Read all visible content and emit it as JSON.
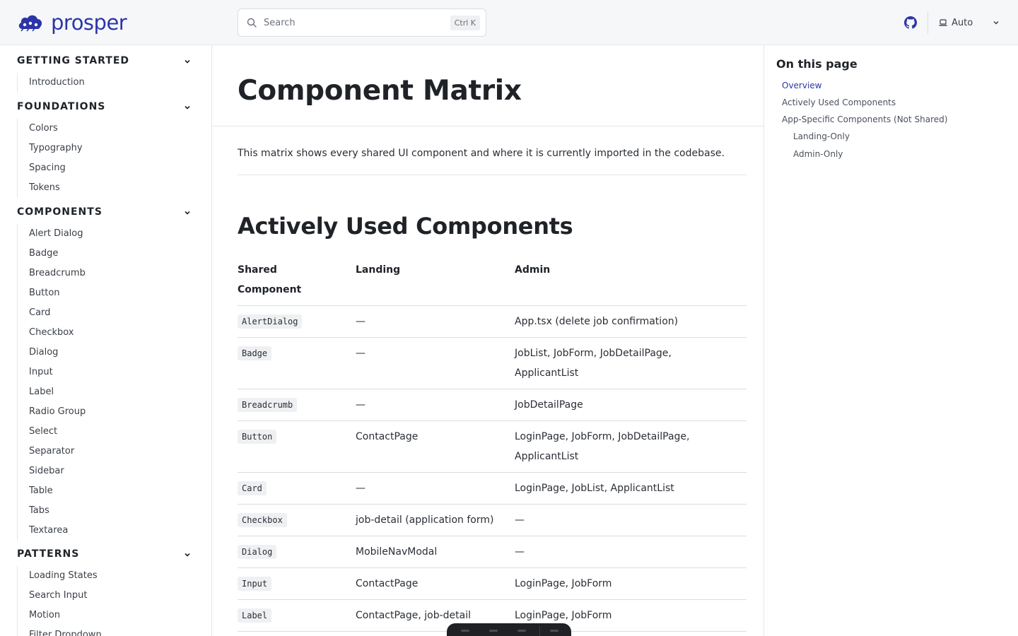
{
  "header": {
    "logo_text": "prosper",
    "search_placeholder": "Search",
    "search_shortcut": "Ctrl K",
    "theme_label": "Auto"
  },
  "sidebar": {
    "sections": [
      {
        "title": "GETTING STARTED",
        "items": [
          "Introduction"
        ]
      },
      {
        "title": "FOUNDATIONS",
        "items": [
          "Colors",
          "Typography",
          "Spacing",
          "Tokens"
        ]
      },
      {
        "title": "COMPONENTS",
        "items": [
          "Alert Dialog",
          "Badge",
          "Breadcrumb",
          "Button",
          "Card",
          "Checkbox",
          "Dialog",
          "Input",
          "Label",
          "Radio Group",
          "Select",
          "Separator",
          "Sidebar",
          "Table",
          "Tabs",
          "Textarea"
        ]
      },
      {
        "title": "PATTERNS",
        "items": [
          "Loading States",
          "Search Input",
          "Motion",
          "Filter Dropdown"
        ]
      }
    ]
  },
  "main": {
    "title": "Component Matrix",
    "intro": "This matrix shows every shared UI component and where it is currently imported in the codebase.",
    "section_title": "Actively Used Components",
    "table": {
      "headers": [
        "Shared Component",
        "Landing",
        "Admin"
      ],
      "rows": [
        [
          "AlertDialog",
          "—",
          "App.tsx (delete job confirmation)"
        ],
        [
          "Badge",
          "—",
          "JobList, JobForm, JobDetailPage, ApplicantList"
        ],
        [
          "Breadcrumb",
          "—",
          "JobDetailPage"
        ],
        [
          "Button",
          "ContactPage",
          "LoginPage, JobForm, JobDetailPage, ApplicantList"
        ],
        [
          "Card",
          "—",
          "LoginPage, JobList, ApplicantList"
        ],
        [
          "Checkbox",
          "job-detail (application form)",
          "—"
        ],
        [
          "Dialog",
          "MobileNavModal",
          "—"
        ],
        [
          "Input",
          "ContactPage",
          "LoginPage, JobForm"
        ],
        [
          "Label",
          "ContactPage, job-detail",
          "LoginPage, JobForm"
        ]
      ]
    }
  },
  "toc": {
    "title": "On this page",
    "items": [
      {
        "label": "Overview",
        "level": 1,
        "active": true
      },
      {
        "label": "Actively Used Components",
        "level": 1,
        "active": false
      },
      {
        "label": "App-Specific Components (Not Shared)",
        "level": 1,
        "active": false
      },
      {
        "label": "Landing-Only",
        "level": 2,
        "active": false
      },
      {
        "label": "Admin-Only",
        "level": 2,
        "active": false
      }
    ]
  },
  "colors": {
    "brand": "#2c35a8",
    "text": "#1f2328",
    "border": "#e4e6ea",
    "header_bg": "#f6f7f9"
  }
}
